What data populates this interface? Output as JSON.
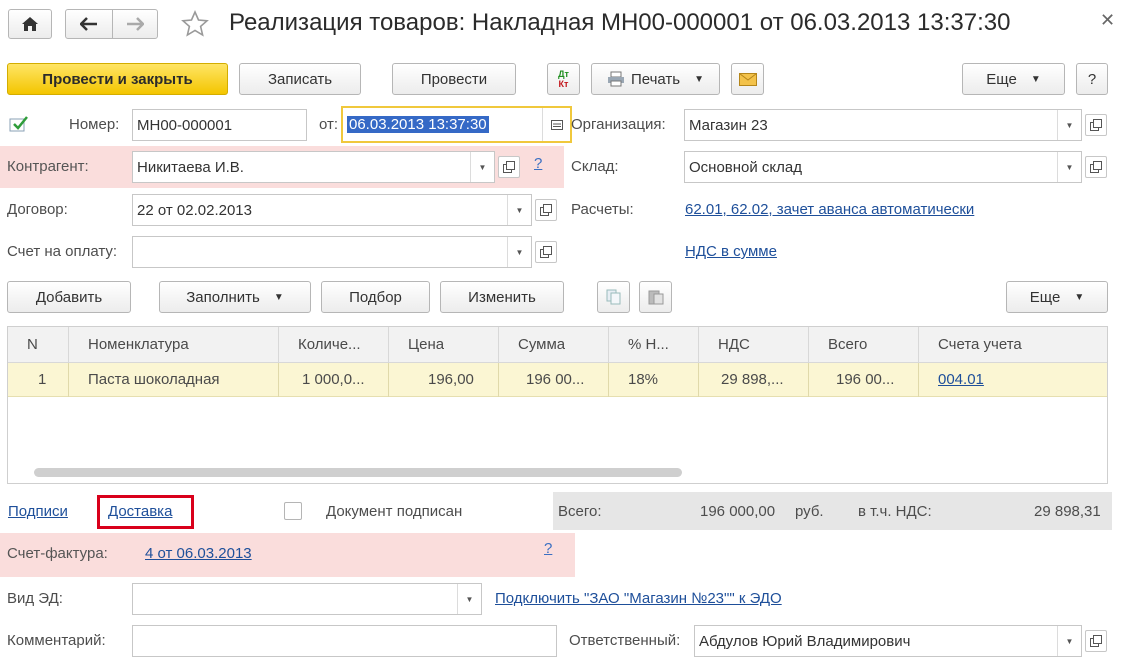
{
  "header": {
    "title": "Реализация товаров: Накладная МН00-000001 от 06.03.2013 13:37:30"
  },
  "toolbar": {
    "post_close": "Провести и закрыть",
    "write": "Записать",
    "post": "Провести",
    "dtkt_top": "Дт",
    "dtkt_bottom": "Кт",
    "print": "Печать",
    "more": "Еще",
    "help": "?"
  },
  "form": {
    "number_label": "Номер:",
    "number_value": "МН00-000001",
    "from_label": "от:",
    "date_value": "06.03.2013 13:37:30",
    "org_label": "Организация:",
    "org_value": "Магазин 23",
    "contractor_label": "Контрагент:",
    "contractor_value": "Никитаева И.В.",
    "contractor_help": "?",
    "warehouse_label": "Склад:",
    "warehouse_value": "Основной склад",
    "contract_label": "Договор:",
    "contract_value": "22 от 02.02.2013",
    "settlements_label": "Расчеты:",
    "settlements_link": "62.01, 62.02, зачет аванса автоматически",
    "invoice_label": "Счет на оплату:",
    "invoice_value": "",
    "vat_link": "НДС в сумме"
  },
  "table_toolbar": {
    "add": "Добавить",
    "fill": "Заполнить",
    "pick": "Подбор",
    "change": "Изменить",
    "more": "Еще"
  },
  "table": {
    "columns": [
      "N",
      "Номенклатура",
      "Количе...",
      "Цена",
      "Сумма",
      "% Н...",
      "НДС",
      "Всего",
      "Счета учета"
    ],
    "rows": [
      [
        "1",
        "Паста шоколадная",
        "1 000,0...",
        "196,00",
        "196 00...",
        "18%",
        "29 898,...",
        "196 00...",
        "004.01"
      ]
    ]
  },
  "footer": {
    "signatures_link": "Подписи",
    "delivery_link": "Доставка",
    "signed_label": "Документ подписан",
    "total_label": "Всего:",
    "total_value": "196 000,00",
    "currency": "руб.",
    "vat_incl_label": "в т.ч. НДС:",
    "vat_value": "29 898,31",
    "sf_label": "Счет-фактура:",
    "sf_link": "4 от 06.03.2013",
    "sf_help": "?",
    "ed_label": "Вид ЭД:",
    "ed_value": "",
    "edo_link": "Подключить \"ЗАО \"Магазин №23\"\" к ЭДО",
    "comment_label": "Комментарий:",
    "comment_value": "",
    "responsible_label": "Ответственный:",
    "responsible_value": "Абдулов Юрий Владимирович"
  },
  "colors": {
    "primary_button": "#f3c500",
    "link": "#1e4f9a",
    "highlight_row": "#fbf6d3",
    "required_band": "#fadddc",
    "delivery_frame": "#d9001b"
  }
}
